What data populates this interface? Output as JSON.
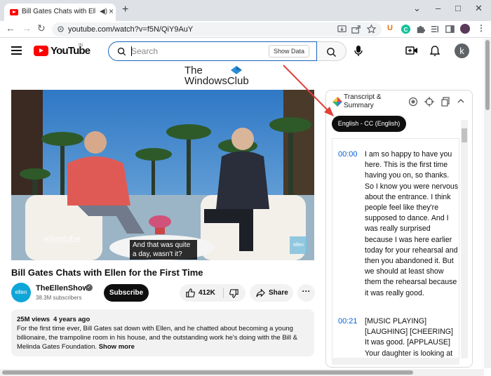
{
  "browser": {
    "tab_title": "Bill Gates Chats with Ellen fo",
    "url": "youtube.com/watch?v=f5N/QiY9AuY",
    "new_tab": "+",
    "win_minimize": "–",
    "win_maximize": "□",
    "win_close": "✕"
  },
  "youtube": {
    "logo_text": "YouTube",
    "region": "IN",
    "search_placeholder": "Search",
    "show_data_label": "Show Data",
    "avatar_letter": "k"
  },
  "watermark": {
    "line1": "The",
    "line2": "WindowsClub"
  },
  "video": {
    "caption_line1": "And that was quite",
    "caption_line2": "a day, wasn't it?",
    "brand": "ellentube",
    "bug": "ellen",
    "title": "Bill Gates Chats with Ellen for the First Time",
    "channel_logo": "ellen",
    "channel_name": "TheEllenShow",
    "subscribers": "38.3M subscribers",
    "subscribe_label": "Subscribe",
    "likes": "412K",
    "share_label": "Share",
    "more_label": "···"
  },
  "description": {
    "views": "25M views",
    "age": "4 years ago",
    "text": "For the first time ever, Bill Gates sat down with Ellen, and he chatted about becoming a young billionaire, the trampoline room in his house, and the outstanding work he's doing with the Bill & Melinda Gates Foundation.",
    "show_more": "Show more"
  },
  "transcript": {
    "title_line1": "Transcript &",
    "title_line2": "Summary",
    "language_button": "English - CC (English)",
    "entries": [
      {
        "time": "00:00",
        "text": "I am so happy to have you here. This is the first time having you on, so thanks. So I know you were nervous about the entrance. I think people feel like they're supposed to dance. And I was really surprised because I was here earlier today for your rehearsal and then you abandoned it. But we should at least show them the rehearsal because it was really good."
      },
      {
        "time": "00:21",
        "text": "[MUSIC PLAYING] [LAUGHING] [CHEERING] It was good. [APPLAUSE] Your daughter is looking at"
      }
    ]
  },
  "colors": {
    "youtube_red": "#FF0000",
    "link_blue": "#065FD4",
    "annotation_red": "#E0403A"
  }
}
